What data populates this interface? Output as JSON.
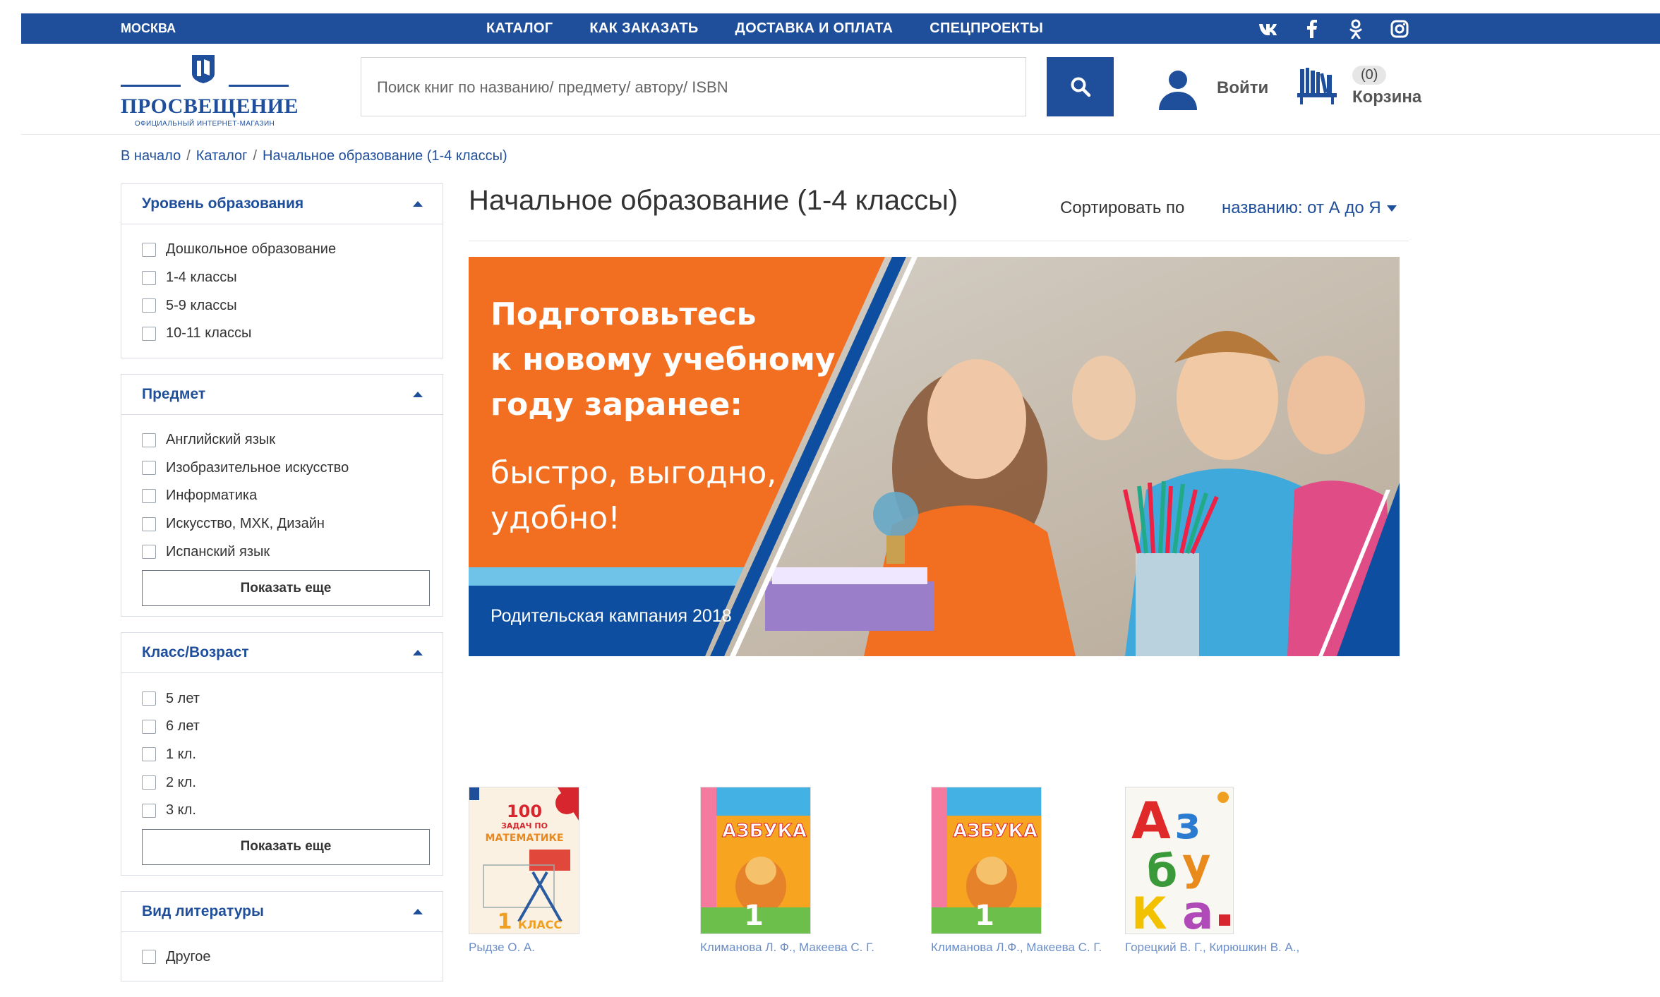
{
  "topbar": {
    "city": "МОСКВА",
    "nav": [
      "КАТАЛОГ",
      "КАК ЗАКАЗАТЬ",
      "ДОСТАВКА И ОПЛАТА",
      "СПЕЦПРОЕКТЫ"
    ],
    "social": [
      "vk-icon",
      "facebook-icon",
      "odnoklassniki-icon",
      "instagram-icon"
    ]
  },
  "header": {
    "logo_name": "ПРОСВЕЩЕНИЕ",
    "logo_sub": "ОФИЦИАЛЬНЫЙ ИНТЕРНЕТ-МАГАЗИН",
    "search_placeholder": "Поиск книг по названию/ предмету/ автору/ ISBN",
    "login": "Войти",
    "cart_count": "(0)",
    "cart_label": "Корзина"
  },
  "breadcrumb": [
    "В начало",
    "Каталог",
    "Начальное образование (1-4 классы)"
  ],
  "filters": [
    {
      "title": "Уровень образования",
      "items": [
        "Дошкольное образование",
        "1-4 классы",
        "5-9 классы",
        "10-11 классы"
      ]
    },
    {
      "title": "Предмет",
      "items": [
        "Английский язык",
        "Изобразительное искусство",
        "Информатика",
        "Искусство, МХК, Дизайн",
        "Испанский язык"
      ],
      "more": "Показать еще"
    },
    {
      "title": "Класс/Возраст",
      "items": [
        "5 лет",
        "6 лет",
        "1 кл.",
        "2 кл.",
        "3 кл."
      ],
      "more": "Показать еще"
    },
    {
      "title": "Вид литературы",
      "items": [
        "Другое"
      ]
    }
  ],
  "main": {
    "title": "Начальное образование (1-4 классы)",
    "sort_label": "Сортировать по",
    "sort_value": "названию: от А до Я"
  },
  "banner": {
    "headline": [
      "Подготовьтесь",
      "к новому учебному",
      "году заранее:"
    ],
    "subline": [
      "быстро, выгодно,",
      "удобно!"
    ],
    "campaign": "Родительская кампания 2018",
    "colors": {
      "orange": "#f26f21",
      "blue": "#0d4ea0"
    }
  },
  "products": [
    {
      "author": "Рыдзе О. А.",
      "cover": {
        "lines": [
          "100",
          "ЗАДАЧ ПО",
          "МАТЕМАТИКЕ",
          "1 КЛАСС"
        ]
      }
    },
    {
      "author": "Климанова Л. Ф., Макеева С. Г.",
      "cover": {
        "lines": [
          "АЗБУКА",
          "1"
        ]
      }
    },
    {
      "author": "Климанова Л.Ф., Макеева С. Г.",
      "cover": {
        "lines": [
          "АЗБУКА",
          "1"
        ]
      }
    },
    {
      "author": "Горецкий В. Г., Кирюшкин В. А., Виноградская Л. А. и др.",
      "cover": {
        "lines": [
          "Аз",
          "бу",
          "ка"
        ]
      }
    }
  ],
  "colors": {
    "brand": "#1f4e9b",
    "link": "#1f4e9b"
  }
}
